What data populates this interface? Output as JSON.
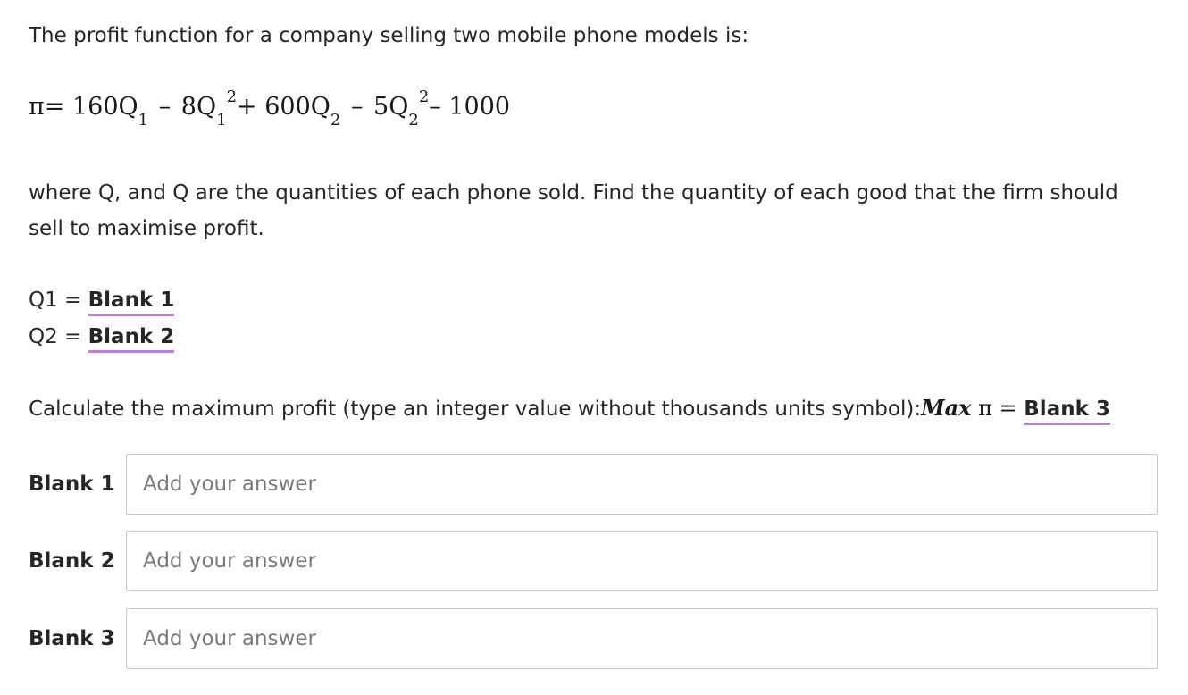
{
  "question": {
    "intro": "The profit function for a company selling two mobile phone models is:",
    "formula": {
      "pi": "π",
      "eq": "=",
      "t1": "160Q",
      "t1_sub": "1",
      "op1": "–",
      "t2": "8Q",
      "t2_sub": "1",
      "t2_sup": "2",
      "op2": "+",
      "t3": "600Q",
      "t3_sub": "2",
      "op3": "–",
      "t4": "5Q",
      "t4_sub": "2",
      "t4_sup": "2",
      "op4": "–",
      "t5": "1000"
    },
    "where_text": "where Q, and Q are the quantities of each phone sold. Find the quantity of each good that the firm should sell to maximise profit.",
    "q1_prefix": "Q1 = ",
    "q1_blank": "Blank 1",
    "q2_prefix": "Q2 = ",
    "q2_blank": "Blank 2",
    "calc_text": "Calculate the maximum profit (type an integer value without thousands units symbol):",
    "calc_math_max": "Max",
    "calc_math_pi": " π = ",
    "calc_blank": "Blank 3"
  },
  "answers": [
    {
      "label": "Blank 1",
      "value": "",
      "placeholder": "Add your answer"
    },
    {
      "label": "Blank 2",
      "value": "",
      "placeholder": "Add your answer"
    },
    {
      "label": "Blank 3",
      "value": "",
      "placeholder": "Add your answer"
    }
  ],
  "colors": {
    "blank_underline": "#c47ad8",
    "text": "#262626",
    "input_border": "#c8c8c8"
  }
}
